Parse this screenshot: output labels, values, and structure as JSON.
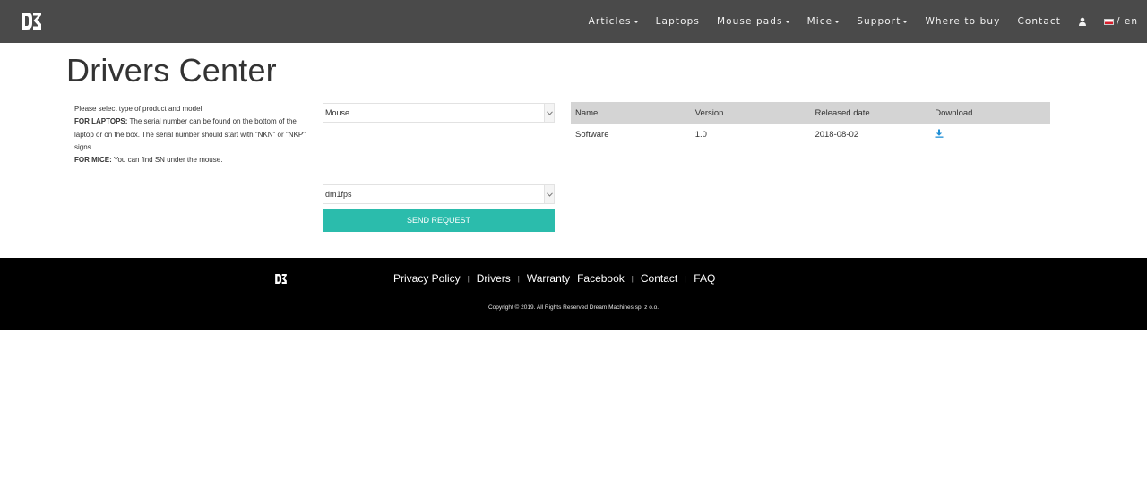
{
  "header": {
    "nav": [
      {
        "label": "Articles",
        "dropdown": true
      },
      {
        "label": "Laptops",
        "dropdown": false
      },
      {
        "label": "Mouse pads",
        "dropdown": true
      },
      {
        "label": "Mice",
        "dropdown": true
      },
      {
        "label": "Support",
        "dropdown": true
      },
      {
        "label": "Where to buy",
        "dropdown": false
      },
      {
        "label": "Contact",
        "dropdown": false
      }
    ],
    "user_icon": "user-icon",
    "language": "/ en",
    "flag": "pl-flag-icon",
    "bar_color": "#4a4a4a"
  },
  "page": {
    "title": "Drivers Center"
  },
  "instructions": {
    "line1": "Please select type of product and model.",
    "laptops_label": "FOR LAPTOPS:",
    "laptops_text": " The serial number can be found on the bottom of the laptop or on the box. The serial number should start with \"NKN\" or \"NKP\" signs.",
    "mice_label": "FOR MICE:",
    "mice_text": " You can find SN under the mouse."
  },
  "form": {
    "product_select": "Mouse",
    "model_select": "dm1fps",
    "send_label": "SEND REQUEST",
    "button_color": "#2bbcac"
  },
  "table": {
    "headers": [
      "Name",
      "Version",
      "Released date",
      "Download"
    ],
    "rows": [
      {
        "name": "Software",
        "version": "1.0",
        "date": "2018-08-02",
        "download_icon": "download-icon"
      }
    ],
    "header_bg": "#d4d4d4",
    "icon_color": "#1f8fd6"
  },
  "footer": {
    "links": [
      "Privacy Policy",
      "Drivers",
      "Warranty",
      "Facebook",
      "Contact",
      "FAQ"
    ],
    "separator": "|",
    "copyright": "Copyright © 2019. All Rights Reserved Dream Machines sp. z o.o."
  }
}
